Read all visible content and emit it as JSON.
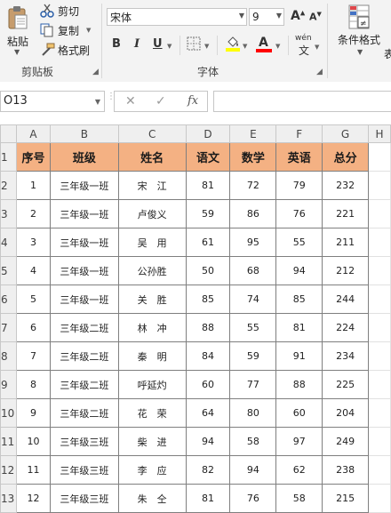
{
  "ribbon": {
    "clipboard": {
      "paste_label": "粘贴",
      "cut_label": "剪切",
      "copy_label": "复制",
      "format_painter_label": "格式刷",
      "group_label": "剪贴板"
    },
    "font": {
      "font_name": "宋体",
      "font_size": "9",
      "bold": "B",
      "italic": "I",
      "underline": "U",
      "font_color_glyph": "A",
      "wen_label": "wén",
      "wen_char": "文",
      "group_label": "字体",
      "fill_color": "#ffff00",
      "text_color": "#ff0000"
    },
    "styles": {
      "conditional_format_label": "条件格式",
      "next_group_fragment": "表"
    }
  },
  "formula_bar": {
    "name_box_value": "O13",
    "fx": "fx"
  },
  "sheet": {
    "columns": [
      "A",
      "B",
      "C",
      "D",
      "E",
      "F",
      "G",
      "H"
    ],
    "header": [
      "序号",
      "班级",
      "姓名",
      "语文",
      "数学",
      "英语",
      "总分"
    ],
    "rows": [
      {
        "num": "2",
        "cells": [
          "1",
          "三年级一班",
          "宋　江",
          "81",
          "72",
          "79",
          "232"
        ]
      },
      {
        "num": "3",
        "cells": [
          "2",
          "三年级一班",
          "卢俊义",
          "59",
          "86",
          "76",
          "221"
        ]
      },
      {
        "num": "4",
        "cells": [
          "3",
          "三年级一班",
          "吴　用",
          "61",
          "95",
          "55",
          "211"
        ]
      },
      {
        "num": "5",
        "cells": [
          "4",
          "三年级一班",
          "公孙胜",
          "50",
          "68",
          "94",
          "212"
        ]
      },
      {
        "num": "6",
        "cells": [
          "5",
          "三年级一班",
          "关　胜",
          "85",
          "74",
          "85",
          "244"
        ]
      },
      {
        "num": "7",
        "cells": [
          "6",
          "三年级二班",
          "林　冲",
          "88",
          "55",
          "81",
          "224"
        ]
      },
      {
        "num": "8",
        "cells": [
          "7",
          "三年级二班",
          "秦　明",
          "84",
          "59",
          "91",
          "234"
        ]
      },
      {
        "num": "9",
        "cells": [
          "8",
          "三年级二班",
          "呼延灼",
          "60",
          "77",
          "88",
          "225"
        ]
      },
      {
        "num": "10",
        "cells": [
          "9",
          "三年级二班",
          "花　荣",
          "64",
          "80",
          "60",
          "204"
        ]
      },
      {
        "num": "11",
        "cells": [
          "10",
          "三年级三班",
          "柴　进",
          "94",
          "58",
          "97",
          "249"
        ]
      },
      {
        "num": "12",
        "cells": [
          "11",
          "三年级三班",
          "李　应",
          "82",
          "94",
          "62",
          "238"
        ]
      },
      {
        "num": "13",
        "cells": [
          "12",
          "三年级三班",
          "朱　仝",
          "81",
          "76",
          "58",
          "215"
        ]
      }
    ],
    "header_row_num": "1",
    "header_fill": "#f4b183"
  }
}
